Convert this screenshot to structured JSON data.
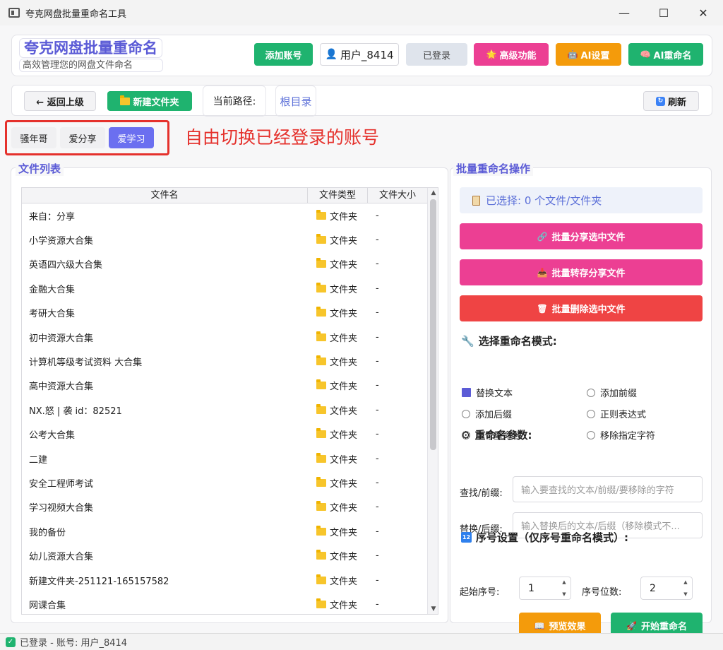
{
  "window": {
    "title": "夸克网盘批量重命名工具",
    "controls": [
      "—",
      "☐",
      "✕"
    ]
  },
  "header": {
    "title": "夸克网盘批量重命名",
    "subtitle": "高效管理您的网盘文件命名",
    "add_account": "添加账号",
    "user": "用户_8414",
    "logged_in": "已登录",
    "advanced": "高级功能",
    "ai_settings": "AI设置",
    "ai_rename": "AI重命名"
  },
  "toolbar": {
    "back": "← 返回上级",
    "new_folder": "新建文件夹",
    "path_label": "当前路径:",
    "path_value": "根目录",
    "refresh": "刷新"
  },
  "accounts": {
    "tabs": [
      "骚年哥",
      "爱分享",
      "爱学习"
    ],
    "active": 2
  },
  "annotation": "自由切换已经登录的账号",
  "file_list": {
    "title": "文件列表",
    "columns": [
      "文件名",
      "文件类型",
      "文件大小"
    ],
    "rows": [
      {
        "name": "来自：分享",
        "type": "文件夹",
        "size": "-"
      },
      {
        "name": "小学资源大合集",
        "type": "文件夹",
        "size": "-"
      },
      {
        "name": "英语四六级大合集",
        "type": "文件夹",
        "size": "-"
      },
      {
        "name": "金融大合集",
        "type": "文件夹",
        "size": "-"
      },
      {
        "name": "考研大合集",
        "type": "文件夹",
        "size": "-"
      },
      {
        "name": "初中资源大合集",
        "type": "文件夹",
        "size": "-"
      },
      {
        "name": "计算机等级考试资料 大合集",
        "type": "文件夹",
        "size": "-"
      },
      {
        "name": "高中资源大合集",
        "type": "文件夹",
        "size": "-"
      },
      {
        "name": "NX.怒 | 袭 id：82521",
        "type": "文件夹",
        "size": "-"
      },
      {
        "name": "公考大合集",
        "type": "文件夹",
        "size": "-"
      },
      {
        "name": "二建",
        "type": "文件夹",
        "size": "-"
      },
      {
        "name": "安全工程师考试",
        "type": "文件夹",
        "size": "-"
      },
      {
        "name": "学习视频大合集",
        "type": "文件夹",
        "size": "-"
      },
      {
        "name": "我的备份",
        "type": "文件夹",
        "size": "-"
      },
      {
        "name": "幼儿资源大合集",
        "type": "文件夹",
        "size": "-"
      },
      {
        "name": "新建文件夹-251121-165157582",
        "type": "文件夹",
        "size": "-"
      },
      {
        "name": "网课合集",
        "type": "文件夹",
        "size": "-"
      }
    ]
  },
  "batch": {
    "title": "批量重命名操作",
    "selected": "已选择: 0 个文件/文件夹",
    "share": "批量分享选中文件",
    "save": "批量转存分享文件",
    "delete": "批量删除选中文件",
    "mode_title": "选择重命名模式:",
    "modes": [
      "替换文本",
      "添加前缀",
      "添加后缀",
      "正则表达式",
      "序号重命名",
      "移除指定字符"
    ],
    "active_mode": 0,
    "params_title": "重命名参数:",
    "find_label": "查找/前缀:",
    "find_placeholder": "输入要查找的文本/前缀/要移除的字符",
    "replace_label": "替换/后缀:",
    "replace_placeholder": "输入替换后的文本/后缀（移除模式不...",
    "seq_title": "序号设置（仅序号重命名模式）:",
    "start_label": "起始序号:",
    "start_value": "1",
    "digits_label": "序号位数:",
    "digits_value": "2",
    "preview": "预览效果",
    "start": "开始重命名"
  },
  "status": {
    "text": "已登录 - 账号: 用户_8414"
  },
  "colors": {
    "accent": "#5b5bd6",
    "green": "#1fb36f",
    "pink": "#ec3f93",
    "orange": "#f49b0b",
    "red": "#ef4444",
    "annotation": "#e5312c"
  }
}
